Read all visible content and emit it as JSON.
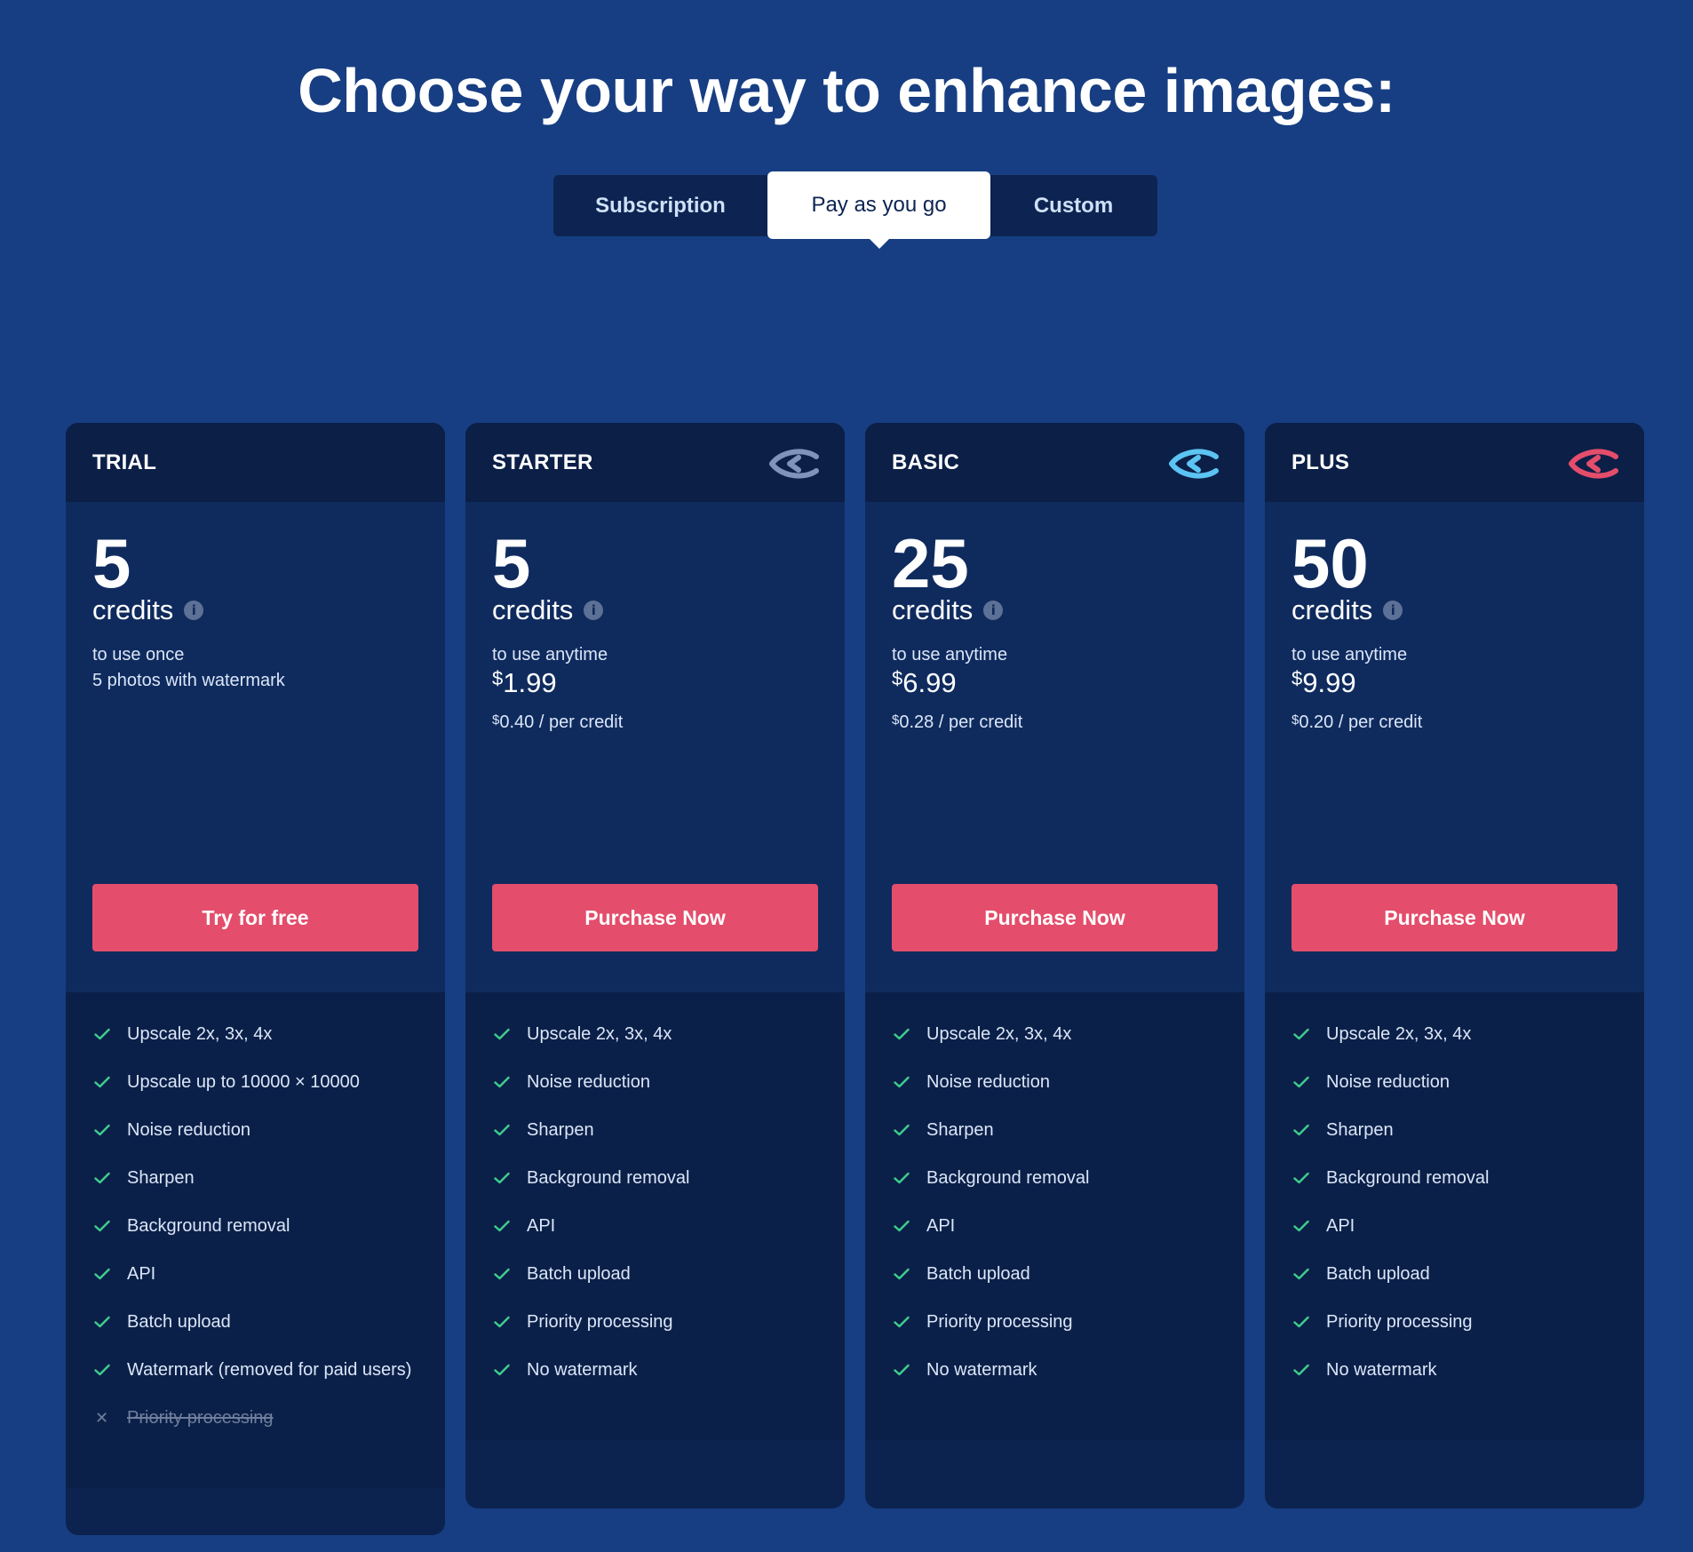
{
  "headline": "Choose your way to enhance images:",
  "tabs": {
    "subscription": "Subscription",
    "pay_as_you_go": "Pay as you go",
    "custom": "Custom",
    "active": "pay_as_you_go"
  },
  "colors": {
    "background": "#173e82",
    "card": "#0c234f",
    "button": "#e44d6b",
    "check": "#3fce8e",
    "starter_icon": "#7f94b8",
    "basic_icon": "#5cc4f2",
    "plus_icon": "#e44d6b"
  },
  "plans": [
    {
      "name": "TRIAL",
      "credits": "5",
      "credits_label": "credits",
      "sub1": "to use once",
      "sub2": "5 photos with watermark",
      "button": "Try for free",
      "features": [
        "Upscale 2x, 3x, 4x",
        "Upscale up to 10000 × 10000",
        "Noise reduction",
        "Sharpen",
        "Background removal",
        "API",
        "Batch upload",
        "Watermark (removed for paid users)"
      ],
      "disabled_feature": "Priority processing"
    },
    {
      "name": "STARTER",
      "icon": "eye-logo-icon",
      "credits": "5",
      "credits_label": "credits",
      "sub1": "to use anytime",
      "currency": "$",
      "price": "1.99",
      "per_credit": "0.40 / per credit",
      "button": "Purchase Now",
      "features": [
        "Upscale 2x, 3x, 4x",
        "Noise reduction",
        "Sharpen",
        "Background removal",
        "API",
        "Batch upload",
        "Priority processing",
        "No watermark"
      ]
    },
    {
      "name": "BASIC",
      "icon": "eye-logo-icon",
      "credits": "25",
      "credits_label": "credits",
      "sub1": "to use anytime",
      "currency": "$",
      "price": "6.99",
      "per_credit": "0.28 / per credit",
      "button": "Purchase Now",
      "features": [
        "Upscale 2x, 3x, 4x",
        "Noise reduction",
        "Sharpen",
        "Background removal",
        "API",
        "Batch upload",
        "Priority processing",
        "No watermark"
      ]
    },
    {
      "name": "PLUS",
      "icon": "eye-logo-icon",
      "credits": "50",
      "credits_label": "credits",
      "sub1": "to use anytime",
      "currency": "$",
      "price": "9.99",
      "per_credit": "0.20 / per credit",
      "button": "Purchase Now",
      "features": [
        "Upscale 2x, 3x, 4x",
        "Noise reduction",
        "Sharpen",
        "Background removal",
        "API",
        "Batch upload",
        "Priority processing",
        "No watermark"
      ]
    }
  ]
}
